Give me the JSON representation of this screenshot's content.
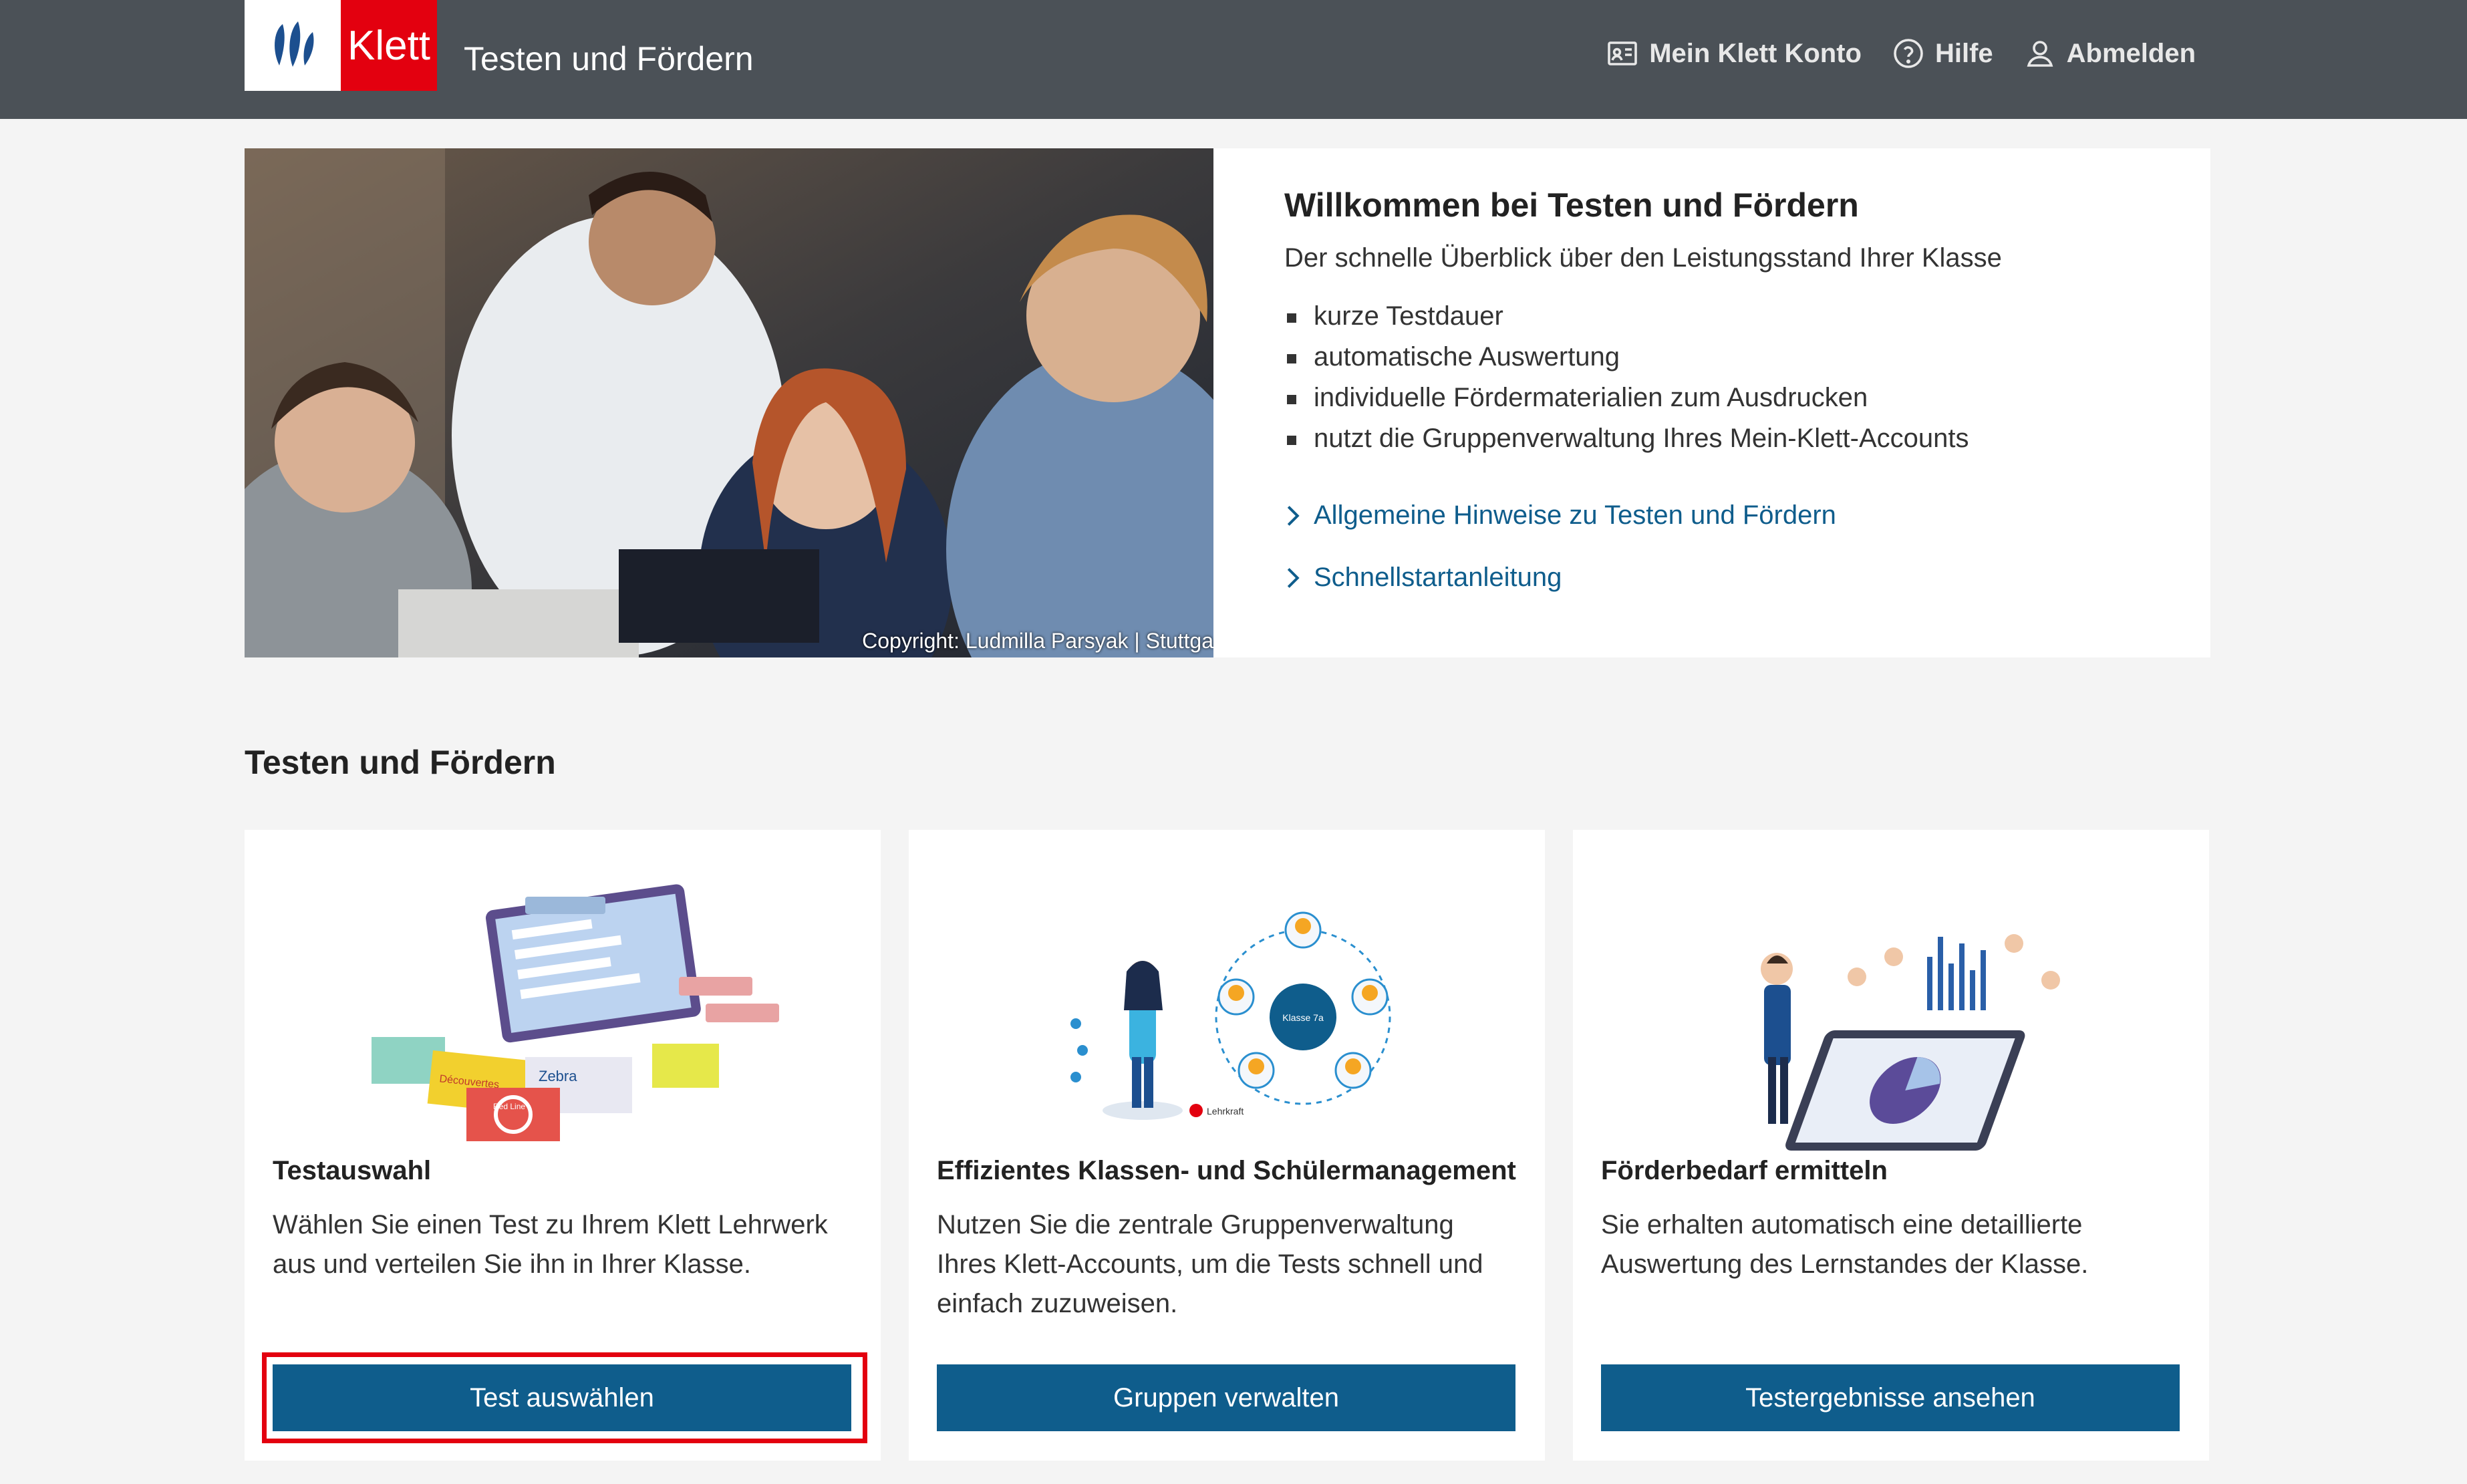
{
  "header": {
    "logo_text": "Klett",
    "app_title": "Testen und Fördern",
    "nav": [
      {
        "label": "Mein Klett Konto",
        "icon": "id-card-icon"
      },
      {
        "label": "Hilfe",
        "icon": "help-circle-icon"
      },
      {
        "label": "Abmelden",
        "icon": "user-icon"
      }
    ]
  },
  "intro": {
    "image_copyright": "Copyright: Ludmilla Parsyak | Stuttga",
    "title": "Willkommen bei Testen und Fördern",
    "subtitle": "Der schnelle Überblick über den Leistungsstand Ihrer Klasse",
    "features": [
      "kurze Testdauer",
      "automatische Auswertung",
      "individuelle Fördermaterialien zum Ausdrucken",
      "nutzt die Gruppenverwaltung Ihres Mein-Klett-Accounts"
    ],
    "links": [
      "Allgemeine Hinweise zu Testen und Fördern",
      "Schnellstartanleitung"
    ]
  },
  "section": {
    "title": "Testen und Fördern"
  },
  "cards": [
    {
      "title": "Testauswahl",
      "description": "Wählen Sie einen Test zu Ihrem Klett Lehrwerk aus und verteilen Sie ihn in Ihrer Klasse.",
      "button": "Test auswählen",
      "illus_labels": [
        "Découvertes",
        "Zebra",
        "Red Line"
      ]
    },
    {
      "title": "Effizientes Klassen- und Schülermanagement",
      "description": "Nutzen Sie die zentrale Gruppenverwaltung Ihres Klett-Accounts, um die Tests schnell und einfach zuzuweisen.",
      "button": "Gruppen verwalten",
      "illus_labels": [
        "Klasse 7a",
        "Lehrkraft"
      ]
    },
    {
      "title": "Förderbedarf ermitteln",
      "description": "Sie erhalten automatisch eine detaillierte Auswertung des Lernstandes der Klasse.",
      "button": "Testergebnisse ansehen"
    }
  ],
  "colors": {
    "header_bg": "#4b5157",
    "brand_red": "#e3000f",
    "link_blue": "#0f5d8c",
    "button_blue": "#0f5d8c"
  }
}
